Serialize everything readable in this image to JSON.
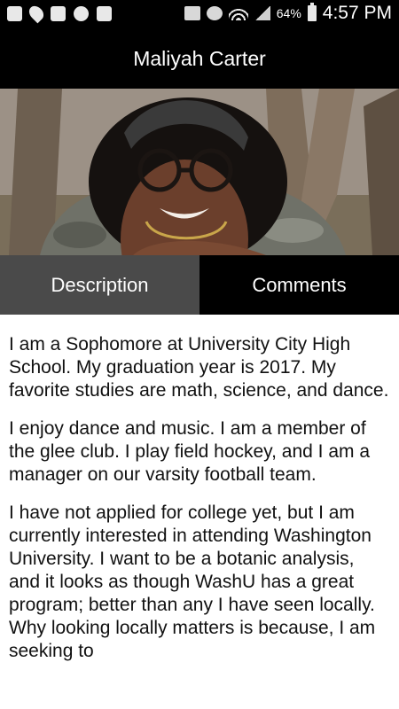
{
  "status_bar": {
    "battery": "64%",
    "time": "4:57 PM",
    "left_icons": [
      "plus-box-icon",
      "location-pin-icon",
      "instagram-icon",
      "check-cloud-icon",
      "flipboard-icon"
    ],
    "right_icons": [
      "mute-icon",
      "alarm-icon",
      "wifi-icon",
      "signal-icon",
      "battery-icon"
    ]
  },
  "app_bar": {
    "title": "Maliyah Carter"
  },
  "profile_photo": {
    "subject": "profile-photo"
  },
  "tabs": [
    {
      "label": "Description",
      "active": true
    },
    {
      "label": "Comments",
      "active": false
    }
  ],
  "description": {
    "paragraphs": [
      "I am a Sophomore at University City High School. My graduation year is 2017. My favorite studies are math, science, and dance.",
      "I enjoy dance and music. I am a member of the glee club. I play field hockey, and I am a manager on our varsity football team.",
      "I have not applied for college yet, but I am currently interested in attending Washington University. I want to be a botanic analysis, and it looks as though WashU has a great program; better than any I have seen locally. Why looking locally matters is because, I am seeking to"
    ]
  }
}
